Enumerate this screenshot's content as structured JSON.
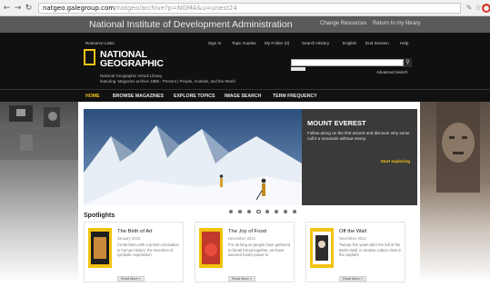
{
  "browser": {
    "back_icon": "back-arrow-icon",
    "forward_icon": "forward-arrow-icon",
    "reload_icon": "reload-icon",
    "url_domain": "natgeo.galegroup.com",
    "url_path": "/natgeo/archive?p=NGMA&u=unest24",
    "extensions": [
      "extension-icon",
      "star-icon",
      "menu-icon"
    ]
  },
  "institution": {
    "name": "National Institute of Development Administration",
    "links": [
      "Change Resources",
      "Return to my library"
    ]
  },
  "header": {
    "left_link": "Resource Links",
    "top_links": [
      "Sign In",
      "Topic Guides",
      "My Folder (0)",
      "Search History",
      "English",
      "End Session",
      "Help"
    ],
    "logo_line1": "NATIONAL",
    "logo_line2": "GEOGRAPHIC",
    "logo_sub1": "National Geographic Virtual Library",
    "logo_sub2": "featuring: Magazine archive 1888 - Present | People, Animals, and the World",
    "advanced_search": "Advanced Search"
  },
  "nav": {
    "items": [
      "HOME",
      "BROWSE MAGAZINES",
      "EXPLORE TOPICS",
      "IMAGE SEARCH",
      "TERM FREQUENCY"
    ]
  },
  "hero": {
    "title": "MOUNT EVEREST",
    "description": "Follow along on the first ascent and discover why some call it a mountain without mercy.",
    "cta": "Start exploring"
  },
  "carousel": {
    "count": 8,
    "active_index": 3
  },
  "spotlights": {
    "heading": "Spotlights",
    "items": [
      {
        "title": "The Birth of Art",
        "date": "January 2015",
        "description": "Credit them with a proven innovation in human history: the invention of symbolic expression",
        "button": "Read More »",
        "thumb_color": "#f1c40f"
      },
      {
        "title": "The Joy of Food",
        "date": "December 2014",
        "description": "For as long as people have gathered to break bread together, we have savored food's power to",
        "button": "Read More »",
        "thumb_color": "#c0392b"
      },
      {
        "title": "Off the Wall",
        "date": "November 2014",
        "description": "Twenty-five years after the fall of the Berlin Wall, a creative culture rises in the capital's",
        "button": "Read More »",
        "thumb_color": "#2c2c2c"
      }
    ]
  },
  "colors": {
    "accent_yellow": "#f3c215",
    "header_black": "#101010",
    "institution_bar": "#5a5a5a"
  }
}
